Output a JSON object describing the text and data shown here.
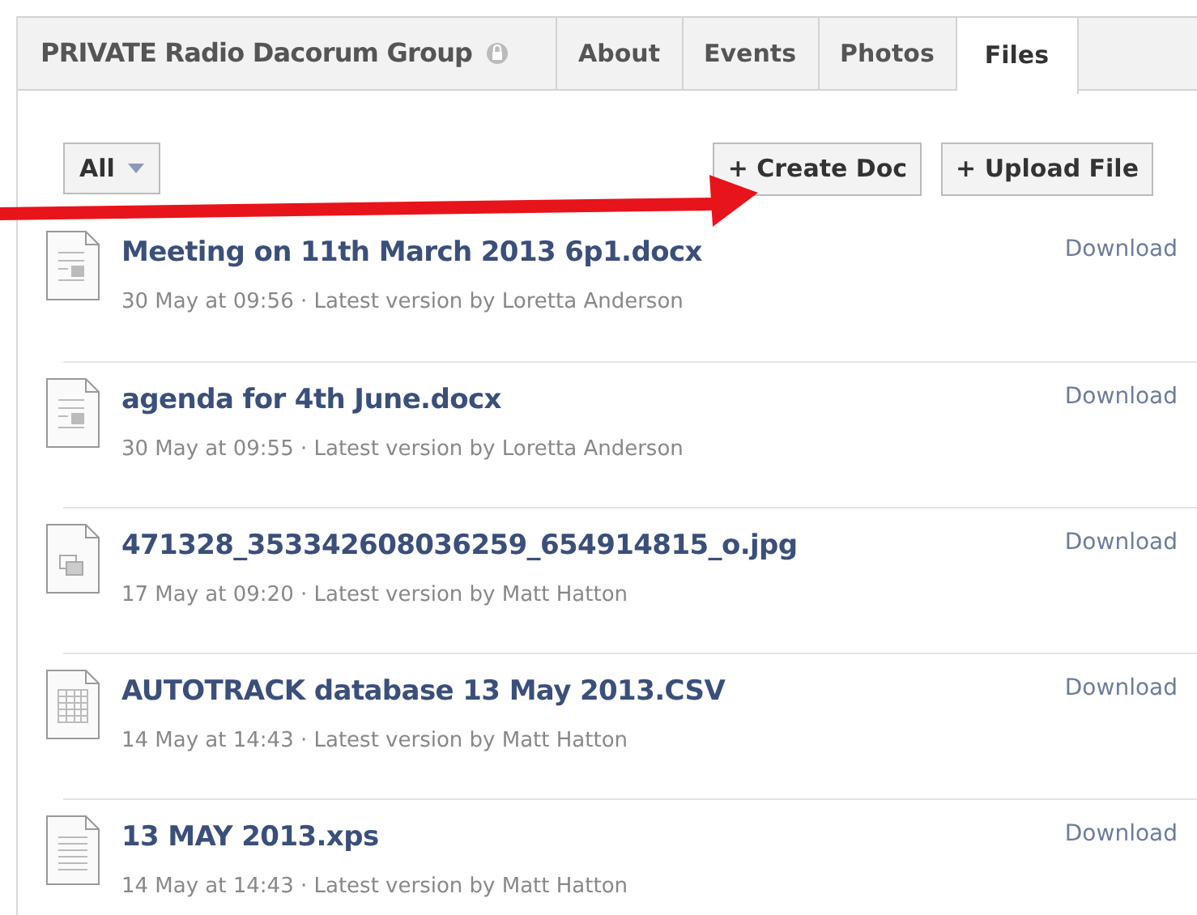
{
  "group": {
    "name": "PRIVATE Radio Dacorum Group",
    "private": true
  },
  "tabs": [
    {
      "label": "About",
      "selected": false
    },
    {
      "label": "Events",
      "selected": false
    },
    {
      "label": "Photos",
      "selected": false
    },
    {
      "label": "Files",
      "selected": true
    }
  ],
  "filter": {
    "value": "All"
  },
  "buttons": [
    "+ Create Doc",
    "+ Upload File"
  ],
  "files": [
    {
      "kind": "doc",
      "name": "Meeting on 11th March 2013 6p1.docx",
      "meta": "30 May at 09:56 · Latest version by Loretta Anderson",
      "action": "Download"
    },
    {
      "kind": "doc",
      "name": "agenda for 4th June.docx",
      "meta": "30 May at 09:55 · Latest version by Loretta Anderson",
      "action": "Download"
    },
    {
      "kind": "image",
      "name": "471328_353342608036259_654914815_o.jpg",
      "meta": "17 May at 09:20 · Latest version by Matt Hatton",
      "action": "Download"
    },
    {
      "kind": "sheet",
      "name": "AUTOTRACK database 13 May 2013.CSV",
      "meta": "14 May at 14:43 · Latest version by Matt Hatton",
      "action": "Download"
    },
    {
      "kind": "text",
      "name": "13 MAY 2013.xps",
      "meta": "14 May at 14:43 · Latest version by Matt Hatton",
      "action": "Download"
    }
  ]
}
